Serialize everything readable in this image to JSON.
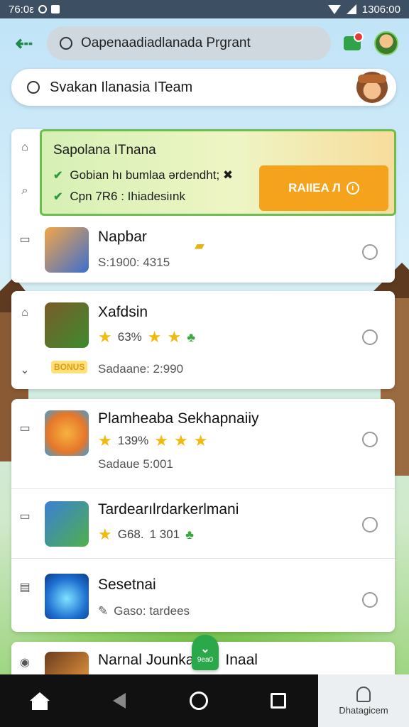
{
  "status_bar": {
    "time": "76:0ε",
    "right_text": "1306:00"
  },
  "top_bar": {
    "search_text": "Oapenaadiadlanada Prgrant"
  },
  "search2": {
    "text": "Svakan Ilanasia ITeam"
  },
  "promo": {
    "title": "Sapolana ITnana",
    "line1": "Gobian hı bumlaa ərdendht; ✖",
    "line2": "Cpn 7R6 : Ihiadesiınk",
    "button_label": "RAIIEA Л"
  },
  "apps": [
    {
      "title": "Napbar",
      "meta": "S:1900: 4315"
    },
    {
      "title": "Xafdsin",
      "rating": "63%",
      "meta": "Sadaane: 2:990",
      "badge": "BONUS"
    },
    {
      "title": "Plamheaba Sekhapnaiiy",
      "rating": "139%",
      "meta": "Sadaue 5:001"
    },
    {
      "title": "Tardearılrdarkerlmani",
      "rating": "G68.",
      "extra": "1 301"
    },
    {
      "title": "Sesetnai",
      "meta": "Gaso: tardees"
    },
    {
      "title": "Narnal Jounka",
      "title_tail": "Inaal"
    }
  ],
  "fab": {
    "label": "9ea0"
  },
  "nav": {
    "diag_label": "Dhatagicem"
  },
  "colors": {
    "accent_green": "#2fa24a",
    "promo_orange": "#f5a31c",
    "star_yellow": "#f2b90f"
  }
}
